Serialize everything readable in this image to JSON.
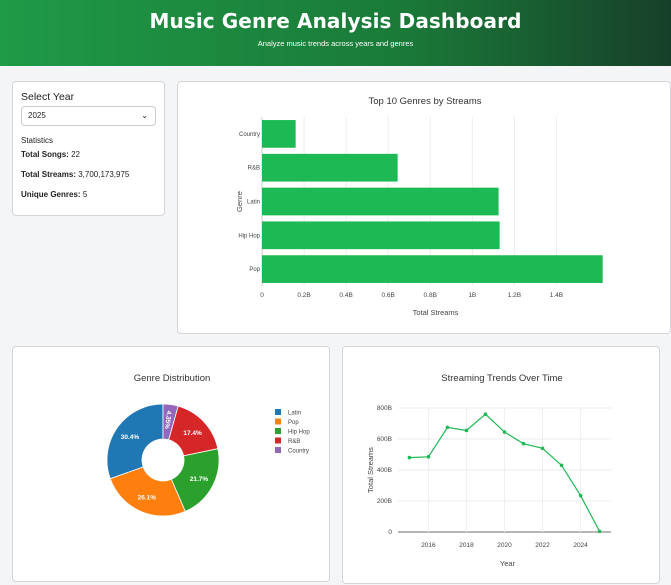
{
  "header": {
    "title": "Music Genre Analysis Dashboard",
    "subtitle": "Analyze music trends across years and genres"
  },
  "sidebar": {
    "select_label": "Select Year",
    "year_value": "2025",
    "stats_heading": "Statistics",
    "total_songs_label": "Total Songs:",
    "total_songs_value": "22",
    "total_streams_label": "Total Streams:",
    "total_streams_value": "3,700,173,975",
    "unique_genres_label": "Unique Genres:",
    "unique_genres_value": "5"
  },
  "colors": {
    "bar": "#1db954",
    "line": "#1db954",
    "latin": "#1f77b4",
    "pop": "#ff7f0e",
    "hiphop": "#2ca02c",
    "rnb": "#d62728",
    "country": "#9467bd"
  },
  "chart_data": [
    {
      "type": "bar",
      "orientation": "horizontal",
      "title": "Top 10 Genres by Streams",
      "xlabel": "Total Streams",
      "ylabel": "Genre",
      "categories": [
        "Country",
        "R&B",
        "Latin",
        "Hip Hop",
        "Pop"
      ],
      "values": [
        160000000,
        645000000,
        1125000000,
        1130000000,
        1620000000
      ],
      "xlim": [
        0,
        1650000000
      ],
      "xticks": [
        0,
        200000000,
        400000000,
        600000000,
        800000000,
        1000000000,
        1200000000,
        1400000000
      ],
      "xtick_labels": [
        "0",
        "0.2B",
        "0.4B",
        "0.6B",
        "0.8B",
        "1B",
        "1.2B",
        "1.4B"
      ],
      "grid": true
    },
    {
      "type": "pie",
      "title": "Genre Distribution",
      "labels": [
        "Latin",
        "Pop",
        "Hip Hop",
        "R&B",
        "Country"
      ],
      "values": [
        30.4,
        26.1,
        21.7,
        17.4,
        4.35
      ],
      "value_labels": [
        "30.4%",
        "26.1%",
        "21.7%",
        "17.4%",
        "4.35%"
      ],
      "legend": "right"
    },
    {
      "type": "line",
      "title": "Streaming Trends Over Time",
      "xlabel": "Year",
      "ylabel": "Total Streams",
      "x": [
        2015,
        2016,
        2017,
        2018,
        2019,
        2020,
        2021,
        2022,
        2023,
        2024,
        2025
      ],
      "y": [
        480000000000,
        485000000000,
        675000000000,
        655000000000,
        760000000000,
        645000000000,
        570000000000,
        540000000000,
        430000000000,
        235000000000,
        4000000000
      ],
      "ylim": [
        0,
        800000000000
      ],
      "xticks": [
        2016,
        2018,
        2020,
        2022,
        2024
      ],
      "xtick_labels": [
        "2016",
        "2018",
        "2020",
        "2022",
        "2024"
      ],
      "yticks": [
        0,
        200000000000,
        400000000000,
        600000000000,
        800000000000
      ],
      "ytick_labels": [
        "0",
        "200B",
        "400B",
        "600B",
        "800B"
      ],
      "grid": true
    }
  ]
}
